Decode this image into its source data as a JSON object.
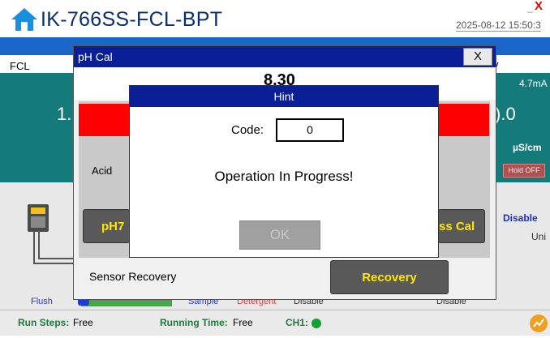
{
  "header": {
    "app_title": "IK-766SS-FCL-BPT",
    "datetime": "2025-08-12 15:50:3",
    "minimize_label": "_",
    "close_label": "X"
  },
  "background": {
    "tab_left": "FCL",
    "tab_right_partial": "y",
    "value_left": "1.",
    "value_right": ").0",
    "ma_reading": "4.7mA",
    "unit": "µS/cm",
    "hold_badge": "Hold OFF",
    "disable_right": "Disable",
    "unit_right_partial": "Uni",
    "labels": {
      "flush": "Flush",
      "sample": "Sample",
      "detergent": "Detergent",
      "disable1": "Disable",
      "disable2": "Disable"
    }
  },
  "statusbar": {
    "run_steps_label": "Run Steps:",
    "run_steps_value": "Free",
    "running_time_label": "Running Time:",
    "running_time_value": "Free",
    "ch1_label": "CH1:"
  },
  "ph_cal_dialog": {
    "title": "pH Cal",
    "close_label": "X",
    "reading": "8.30",
    "acid_label_partial": "Acid",
    "ph7_button_partial": "pH7",
    "cal_button_partial": "ss Cal",
    "recovery_label": "Sensor Recovery",
    "recovery_button": "Recovery"
  },
  "hint_dialog": {
    "title": "Hint",
    "code_label": "Code:",
    "code_value": "0",
    "message": "Operation In Progress!",
    "ok_button": "OK"
  },
  "colors": {
    "title_bar_blue": "#0a1e96",
    "teal_panel": "#157a7a",
    "alarm_red": "#ff0000",
    "button_text_yellow": "#ffe600",
    "status_green": "#12a035"
  }
}
